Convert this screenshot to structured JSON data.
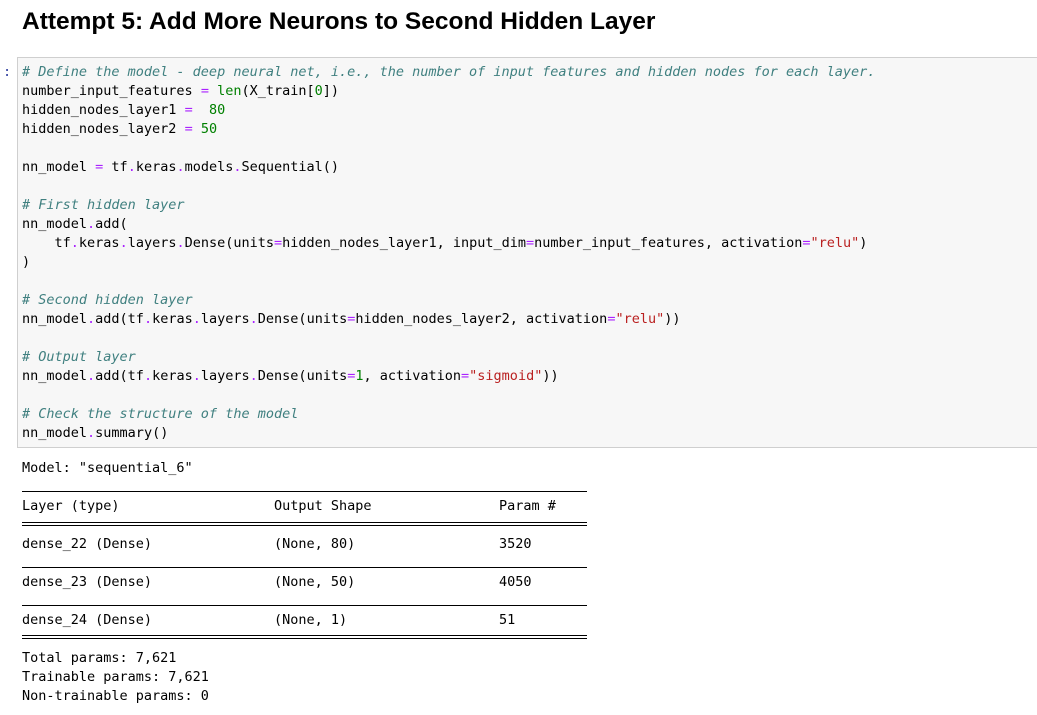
{
  "heading": "Attempt 5: Add More Neurons to Second Hidden Layer",
  "cell": {
    "prompt": ":",
    "code_lines": [
      [
        [
          "c",
          "# Define the model - deep neural net, i.e., the number of input features and hidden nodes for each layer."
        ]
      ],
      [
        [
          "n",
          "number_input_features "
        ],
        [
          "o",
          "="
        ],
        [
          "n",
          " "
        ],
        [
          "b",
          "len"
        ],
        [
          "p",
          "(X_train["
        ],
        [
          "m",
          "0"
        ],
        [
          "p",
          "])"
        ]
      ],
      [
        [
          "n",
          "hidden_nodes_layer1 "
        ],
        [
          "o",
          "="
        ],
        [
          "n",
          "  "
        ],
        [
          "m",
          "80"
        ]
      ],
      [
        [
          "n",
          "hidden_nodes_layer2 "
        ],
        [
          "o",
          "="
        ],
        [
          "n",
          " "
        ],
        [
          "m",
          "50"
        ]
      ],
      [],
      [
        [
          "n",
          "nn_model "
        ],
        [
          "o",
          "="
        ],
        [
          "n",
          " tf"
        ],
        [
          "o",
          "."
        ],
        [
          "n",
          "keras"
        ],
        [
          "o",
          "."
        ],
        [
          "n",
          "models"
        ],
        [
          "o",
          "."
        ],
        [
          "n",
          "Sequential()"
        ]
      ],
      [],
      [
        [
          "c",
          "# First hidden layer"
        ]
      ],
      [
        [
          "n",
          "nn_model"
        ],
        [
          "o",
          "."
        ],
        [
          "n",
          "add("
        ]
      ],
      [
        [
          "n",
          "    tf"
        ],
        [
          "o",
          "."
        ],
        [
          "n",
          "keras"
        ],
        [
          "o",
          "."
        ],
        [
          "n",
          "layers"
        ],
        [
          "o",
          "."
        ],
        [
          "n",
          "Dense(units"
        ],
        [
          "o",
          "="
        ],
        [
          "n",
          "hidden_nodes_layer1, input_dim"
        ],
        [
          "o",
          "="
        ],
        [
          "n",
          "number_input_features, activation"
        ],
        [
          "o",
          "="
        ],
        [
          "s",
          "\"relu\""
        ],
        [
          "p",
          ")"
        ]
      ],
      [
        [
          "p",
          ")"
        ]
      ],
      [],
      [
        [
          "c",
          "# Second hidden layer"
        ]
      ],
      [
        [
          "n",
          "nn_model"
        ],
        [
          "o",
          "."
        ],
        [
          "n",
          "add(tf"
        ],
        [
          "o",
          "."
        ],
        [
          "n",
          "keras"
        ],
        [
          "o",
          "."
        ],
        [
          "n",
          "layers"
        ],
        [
          "o",
          "."
        ],
        [
          "n",
          "Dense(units"
        ],
        [
          "o",
          "="
        ],
        [
          "n",
          "hidden_nodes_layer2, activation"
        ],
        [
          "o",
          "="
        ],
        [
          "s",
          "\"relu\""
        ],
        [
          "p",
          "))"
        ]
      ],
      [],
      [
        [
          "c",
          "# Output layer"
        ]
      ],
      [
        [
          "n",
          "nn_model"
        ],
        [
          "o",
          "."
        ],
        [
          "n",
          "add(tf"
        ],
        [
          "o",
          "."
        ],
        [
          "n",
          "keras"
        ],
        [
          "o",
          "."
        ],
        [
          "n",
          "layers"
        ],
        [
          "o",
          "."
        ],
        [
          "n",
          "Dense(units"
        ],
        [
          "o",
          "="
        ],
        [
          "m",
          "1"
        ],
        [
          "n",
          ", activation"
        ],
        [
          "o",
          "="
        ],
        [
          "s",
          "\"sigmoid\""
        ],
        [
          "p",
          "))"
        ]
      ],
      [],
      [
        [
          "c",
          "# Check the structure of the model"
        ]
      ],
      [
        [
          "n",
          "nn_model"
        ],
        [
          "o",
          "."
        ],
        [
          "n",
          "summary()"
        ]
      ]
    ]
  },
  "summary": {
    "model_line": "Model: \"sequential_6\"",
    "headers": {
      "layer": "Layer (type)",
      "shape": "Output Shape",
      "params": "Param #"
    },
    "rows": [
      {
        "layer": "dense_22 (Dense)",
        "shape": "(None, 80)",
        "params": "3520"
      },
      {
        "layer": "dense_23 (Dense)",
        "shape": "(None, 50)",
        "params": "4050"
      },
      {
        "layer": "dense_24 (Dense)",
        "shape": "(None, 1)",
        "params": "51"
      }
    ],
    "total": "Total params: 7,621",
    "trainable": "Trainable params: 7,621",
    "non_trainable": "Non-trainable params: 0"
  }
}
